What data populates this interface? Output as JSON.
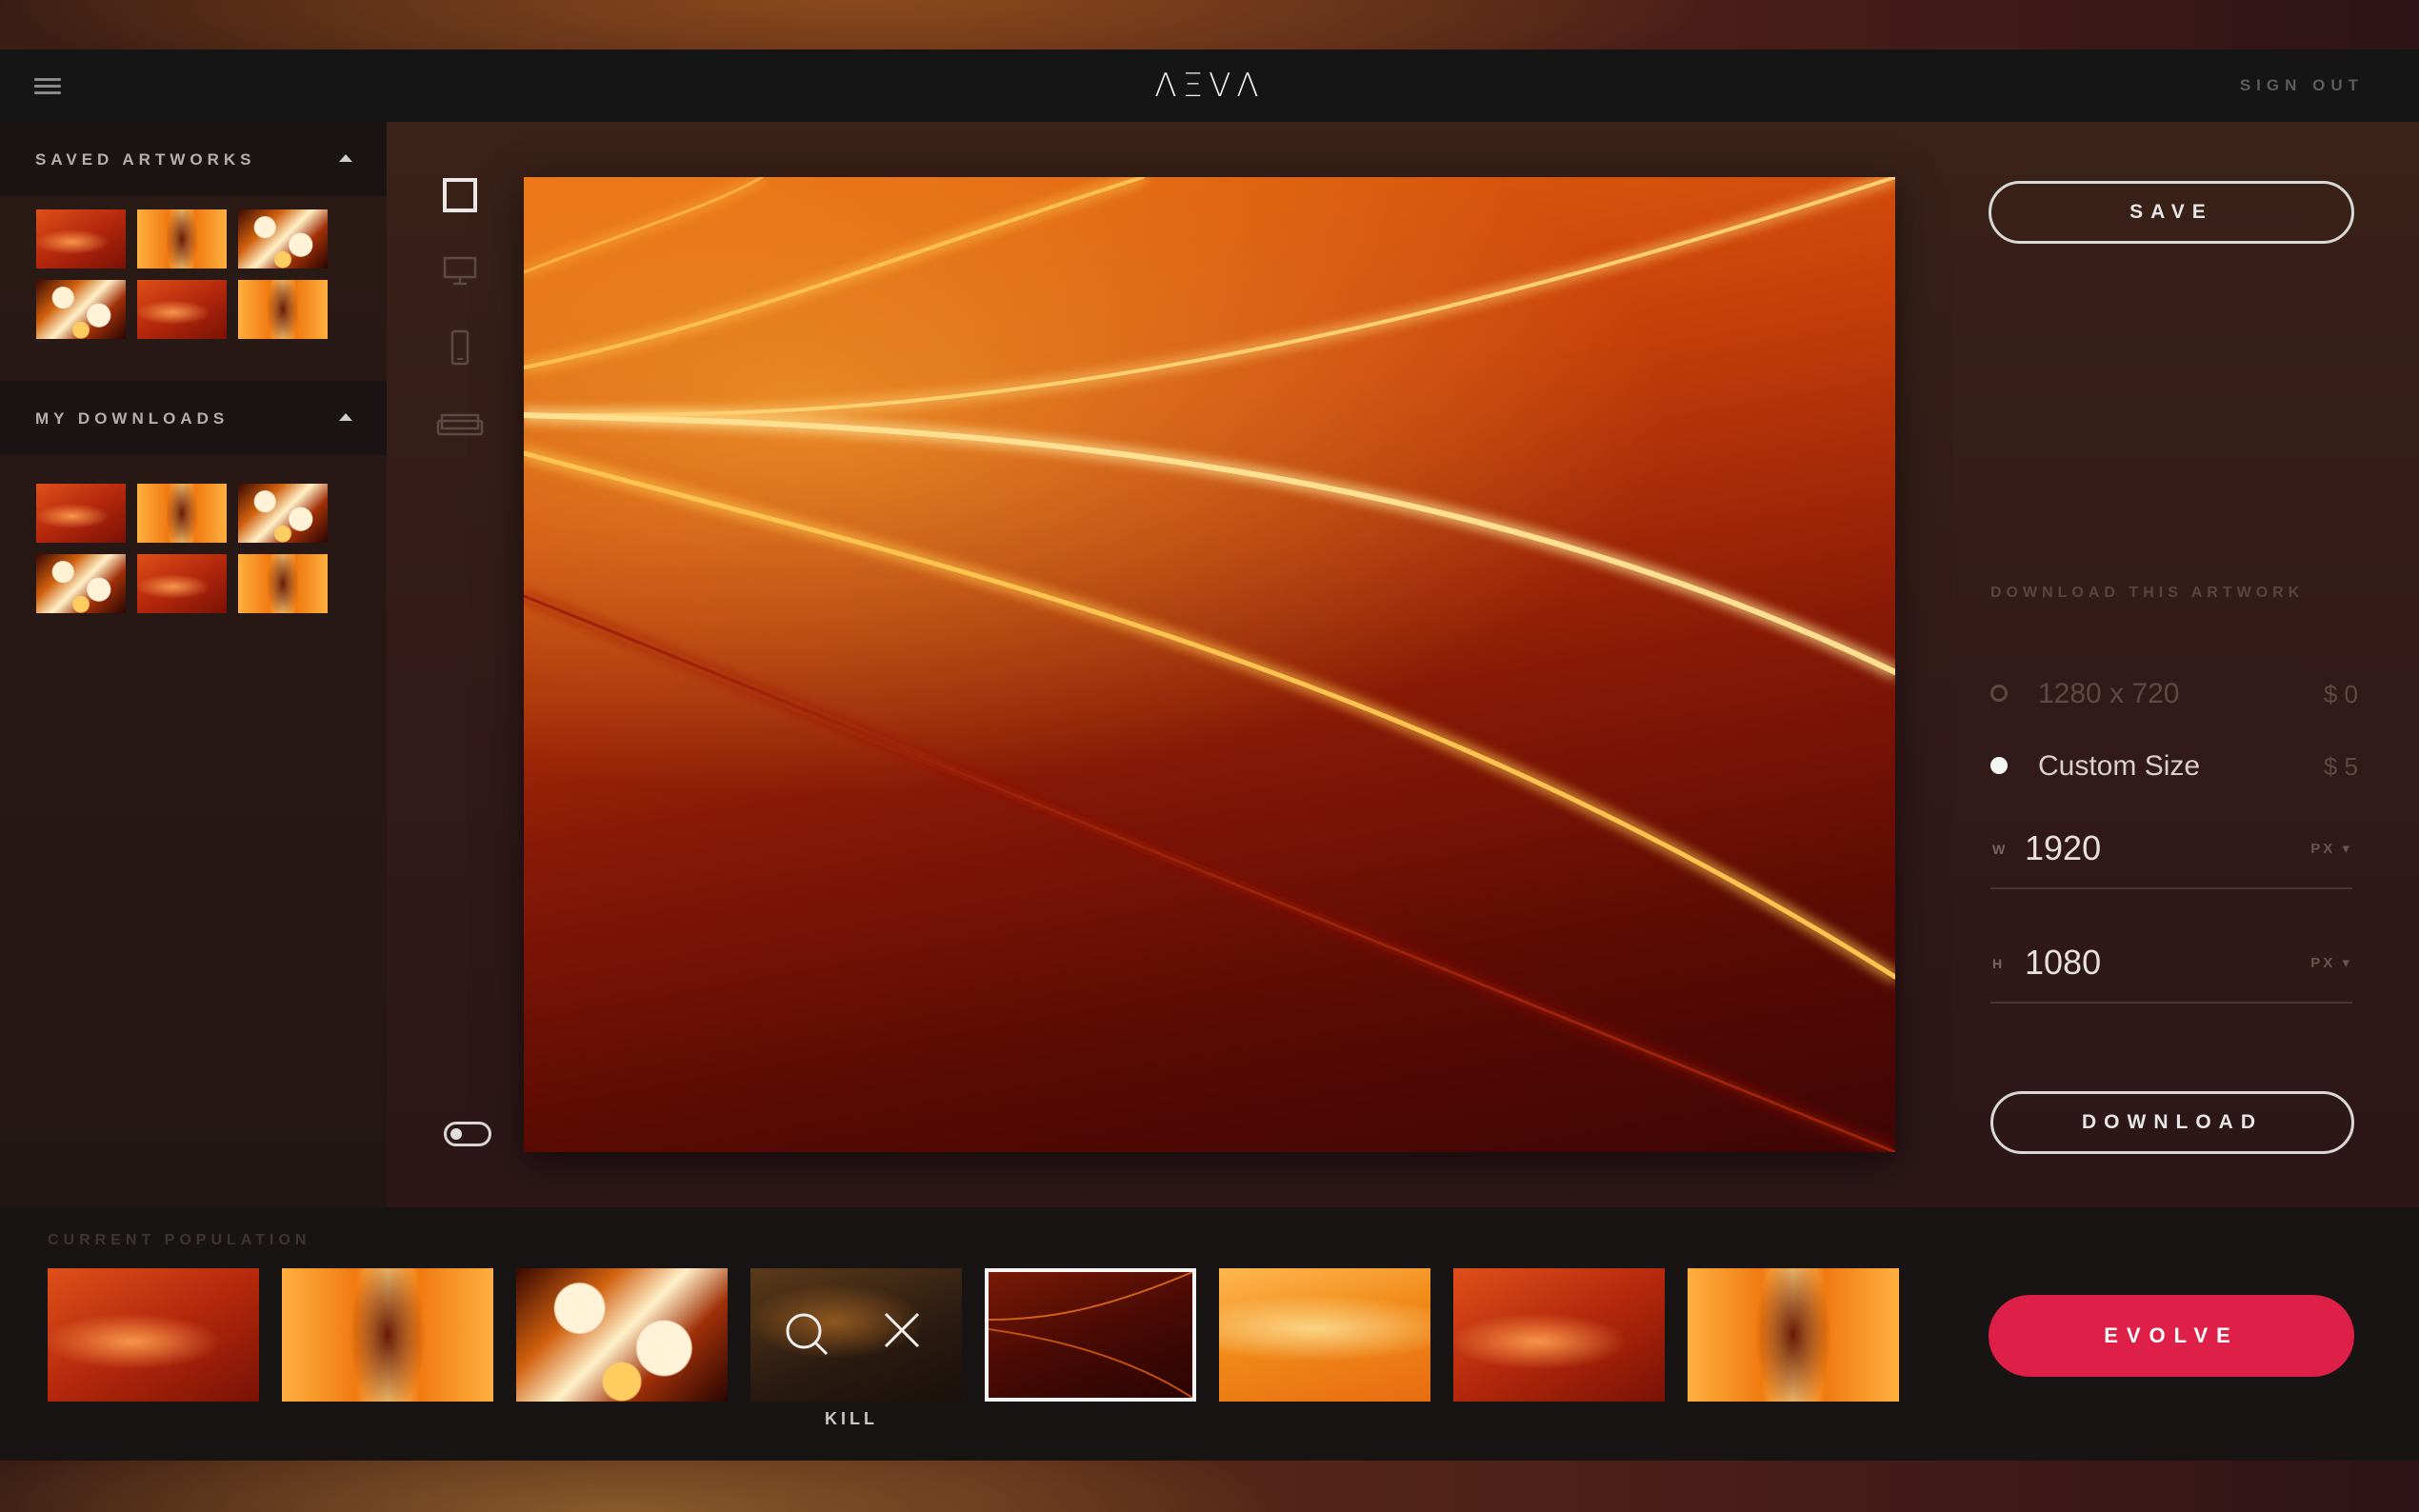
{
  "app": {
    "logo": "ΛΞVΛ",
    "sign_out": "SIGN OUT"
  },
  "sidebar": {
    "saved_title": "SAVED ARTWORKS",
    "downloads_title": "MY DOWNLOADS"
  },
  "right_panel": {
    "save_label": "SAVE",
    "download_title": "DOWNLOAD THIS ARTWORK",
    "options": [
      {
        "label": "1280 x 720",
        "price": "$ 0",
        "selected": false
      },
      {
        "label": "Custom Size",
        "price": "$ 5",
        "selected": true
      }
    ],
    "width": {
      "key": "W",
      "value": "1920",
      "unit": "PX"
    },
    "height": {
      "key": "H",
      "value": "1080",
      "unit": "PX"
    },
    "download_label": "DOWNLOAD"
  },
  "population": {
    "title": "CURRENT POPULATION",
    "kill_label": "KILL",
    "evolve_label": "EVOLVE"
  },
  "colors": {
    "accent": "#de1f48",
    "header_bg": "#151515",
    "panel_text": "#e6e6e6"
  },
  "icons": {
    "menu": "hamburger-icon",
    "caret": "caret-up-icon",
    "frame": "square-frame-icon",
    "desktop": "monitor-icon",
    "phone": "phone-icon",
    "sofa": "sofa-icon",
    "toggle": "toggle-icon",
    "search": "search-icon",
    "close": "close-icon"
  }
}
